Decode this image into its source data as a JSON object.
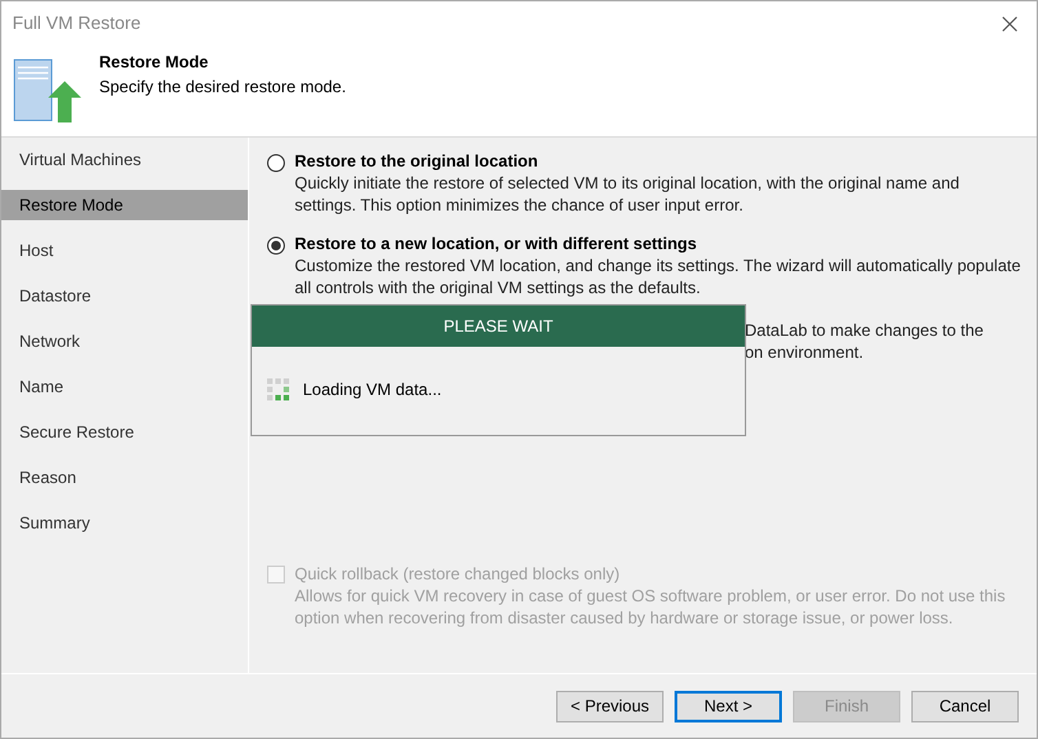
{
  "window": {
    "title": "Full VM Restore"
  },
  "header": {
    "title": "Restore Mode",
    "subtitle": "Specify the desired restore mode."
  },
  "sidebar": {
    "items": [
      {
        "label": "Virtual Machines",
        "selected": false
      },
      {
        "label": "Restore Mode",
        "selected": true
      },
      {
        "label": "Host",
        "selected": false
      },
      {
        "label": "Datastore",
        "selected": false
      },
      {
        "label": "Network",
        "selected": false
      },
      {
        "label": "Name",
        "selected": false
      },
      {
        "label": "Secure Restore",
        "selected": false
      },
      {
        "label": "Reason",
        "selected": false
      },
      {
        "label": "Summary",
        "selected": false
      }
    ]
  },
  "options": [
    {
      "label": "Restore to the original location",
      "description": "Quickly initiate the restore of selected VM to its original location, with the original name and settings. This option minimizes the chance of user input error.",
      "selected": false
    },
    {
      "label": "Restore to a new location, or with different settings",
      "description": "Customize the restored VM location, and change its settings. The wizard will automatically populate all controls with the original VM settings as the defaults.",
      "selected": true
    }
  ],
  "covered_option": {
    "lines": [
      "DataLab to make changes to the",
      "on environment."
    ]
  },
  "quick_rollback": {
    "label": "Quick rollback (restore changed blocks only)",
    "description": "Allows for quick VM recovery in case of guest OS software problem, or user error. Do not use this option when recovering from disaster caused by hardware or storage issue, or power loss.",
    "checked": false,
    "disabled": true
  },
  "wait_dialog": {
    "title": "PLEASE WAIT",
    "message": "Loading VM data..."
  },
  "buttons": [
    {
      "label": "< Previous",
      "kind": "normal"
    },
    {
      "label": "Next >",
      "kind": "default"
    },
    {
      "label": "Finish",
      "kind": "disabled"
    },
    {
      "label": "Cancel",
      "kind": "normal"
    }
  ]
}
